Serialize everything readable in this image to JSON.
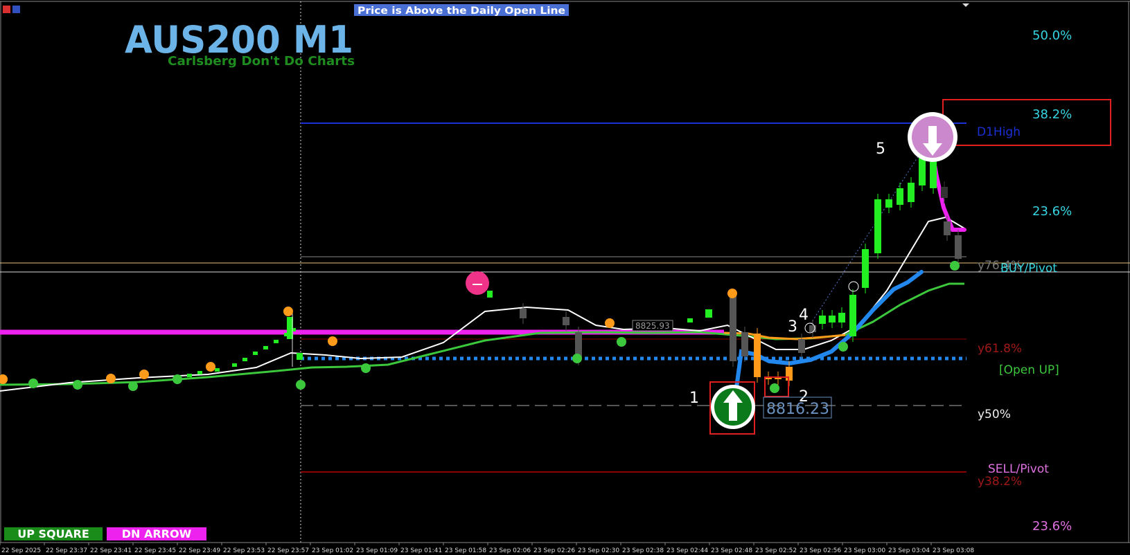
{
  "header": {
    "symbol_title": "AUS200 M1",
    "subtitle": "Carlsberg Don't Do Charts",
    "status_banner": "Price is Above the Daily Open Line"
  },
  "fib_labels": {
    "f50": "50.0%",
    "f382": "38.2%",
    "f236": "23.6%",
    "f236_low": "23.6%"
  },
  "level_labels": {
    "d1high": "D1High",
    "y764": "y76.4%",
    "buy_pivot": "BUY/Pivot",
    "y618": "y61.8%",
    "open_up": "[Open UP]",
    "y50": "y50%",
    "sell_pivot": "SELL/Pivot",
    "y382": "y38.2%"
  },
  "price_labels": {
    "current": "8816.23",
    "mid": "8825.93"
  },
  "wave_labels": [
    "1",
    "2",
    "3",
    "4",
    "5"
  ],
  "buttons": {
    "up_square": "UP SQUARE",
    "dn_arrow": "DN ARROW"
  },
  "time_axis": [
    "22 Sep 2025",
    "22 Sep 23:37",
    "22 Sep 23:41",
    "22 Sep 23:45",
    "22 Sep 23:49",
    "22 Sep 23:53",
    "22 Sep 23:57",
    "23 Sep 01:02",
    "23 Sep 01:09",
    "23 Sep 01:41",
    "23 Sep 01:58",
    "23 Sep 02:06",
    "23 Sep 02:26",
    "23 Sep 02:30",
    "23 Sep 02:38",
    "23 Sep 02:44",
    "23 Sep 02:48",
    "23 Sep 02:52",
    "23 Sep 02:56",
    "23 Sep 03:00",
    "23 Sep 03:04",
    "23 Sep 03:08"
  ],
  "colors": {
    "background": "#000000",
    "title": "#6cb4e8",
    "subtitle": "#1e8c1e",
    "banner_bg": "#4a6fd4",
    "fib_cyan": "#36d4e0",
    "fib_pink": "#e070e0",
    "d1high": "#1a2fd4",
    "dark_red": "#8b0000",
    "open_up": "#3cc83c",
    "up_candle": "#22ee22",
    "down_candle": "#555555",
    "orange": "#ff9a1a",
    "magenta": "#ee22ee",
    "blue_line": "#2288ee",
    "up_square_bg": "#1a8c1a",
    "dn_arrow_bg": "#ee22ee"
  },
  "icons": [
    "chart-menu-icon",
    "chart-properties-icon",
    "up-arrow-signal-icon",
    "down-arrow-signal-icon",
    "pink-circle-signal-icon"
  ]
}
